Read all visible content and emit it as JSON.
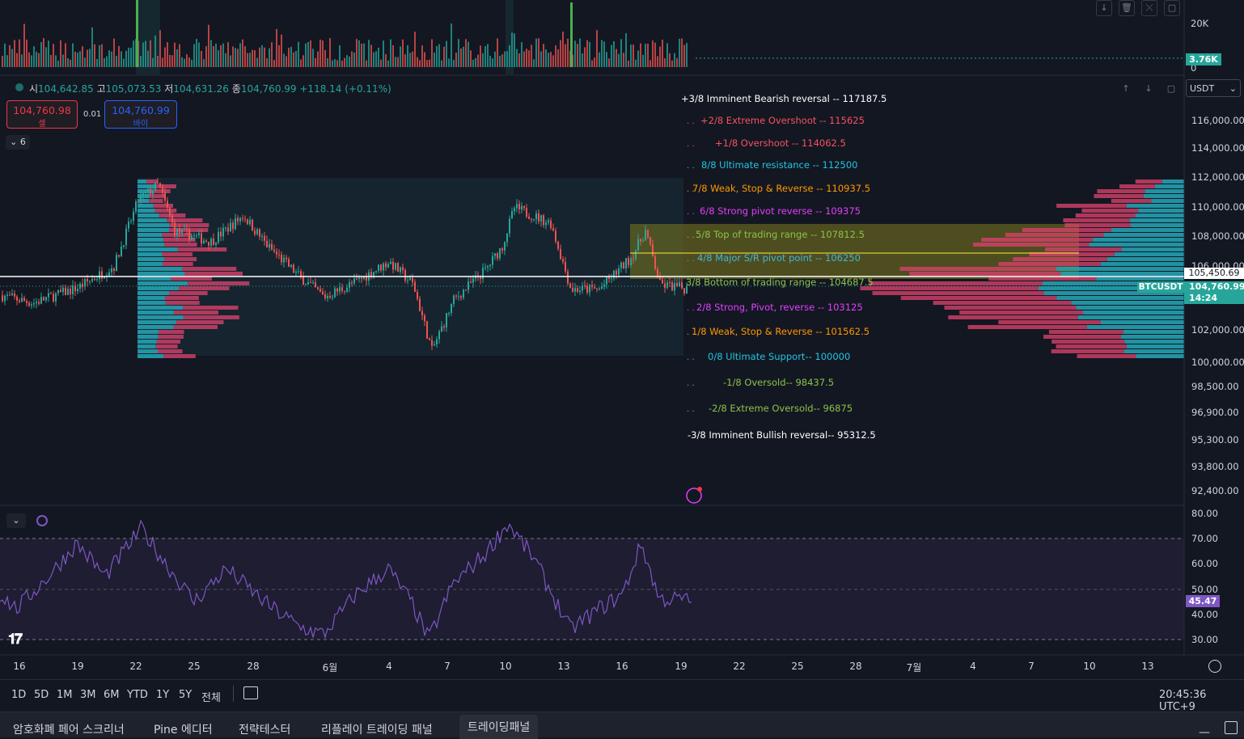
{
  "ohlc": {
    "o_label": "시",
    "o": "104,642.85",
    "h_label": "고",
    "h": "105,073.53",
    "l_label": "저",
    "l": "104,631.26",
    "c_label": "종",
    "c": "104,760.99",
    "change": "+118.14 (+0.11%)"
  },
  "trade": {
    "sell_price": "104,760.98",
    "sell_label": "셀",
    "spread": "0.01",
    "buy_price": "104,760.99",
    "buy_label": "바이"
  },
  "indicator_count": "6",
  "currency": "USDT",
  "volume_axis": {
    "top": "20K",
    "zero": "0",
    "current": "3.76K"
  },
  "price_axis": {
    "labels": [
      "116,000.00",
      "114,000.00",
      "112,000.00",
      "110,000.00",
      "108,000.00",
      "106,000.00",
      "102,000.00",
      "100,000.00",
      "98,500.00",
      "96,900.00",
      "95,300.00",
      "93,800.00",
      "92,400.00"
    ],
    "line_price": "105,450.69",
    "symbol": "BTCUSDT",
    "last_price": "104,760.99",
    "countdown": "14:24"
  },
  "murrey_math": [
    {
      "text": "+3/8 Imminent Bearish reversal --  117187.5",
      "color": "#ffffff"
    },
    {
      "text": "+2/8 Extreme Overshoot --  115625",
      "color": "#f7525f"
    },
    {
      "text": "+1/8 Overshoot --  114062.5",
      "color": "#f7525f"
    },
    {
      "text": "8/8 Ultimate resistance --  112500",
      "color": "#22c5e0"
    },
    {
      "text": "7/8 Weak, Stop & Reverse --  110937.5",
      "color": "#ff9800"
    },
    {
      "text": "6/8 Strong pivot reverse --  109375",
      "color": "#e040fb"
    },
    {
      "text": "5/8 Top of trading range --  107812.5",
      "color": "#8bc34a"
    },
    {
      "text": "4/8 Major S/R pivot point --  106250",
      "color": "#42b5d8"
    },
    {
      "text": "3/8 Bottom of trading range --  104687.5",
      "color": "#8bc34a"
    },
    {
      "text": "2/8 Strong, Pivot, reverse --  103125",
      "color": "#e040fb"
    },
    {
      "text": "1/8 Weak, Stop & Reverse --  101562.5",
      "color": "#ff9800"
    },
    {
      "text": "0/8 Ultimate Support--  100000",
      "color": "#22c5e0"
    },
    {
      "text": "-1/8 Oversold--  98437.5",
      "color": "#8bc34a"
    },
    {
      "text": "-2/8 Extreme Oversold--  96875",
      "color": "#8bc34a"
    },
    {
      "text": "-3/8 Imminent Bullish reversal--  95312.5",
      "color": "#ffffff"
    }
  ],
  "rsi_axis": {
    "labels": [
      "80.00",
      "70.00",
      "60.00",
      "50.00",
      "40.00",
      "30.00"
    ],
    "current": "45.47"
  },
  "time_axis": [
    "16",
    "19",
    "22",
    "25",
    "28",
    "6월",
    "4",
    "7",
    "10",
    "13",
    "16",
    "19",
    "22",
    "25",
    "28",
    "7월",
    "4",
    "7",
    "10",
    "13"
  ],
  "ranges": [
    "1D",
    "5D",
    "1M",
    "3M",
    "6M",
    "YTD",
    "1Y",
    "5Y",
    "전체"
  ],
  "clock": "20:45:36 UTC+9",
  "tabs": [
    "암호화폐 페어 스크리너",
    "Pine 에디터",
    "전략테스터",
    "리플레이 트레이딩 패널",
    "트레이딩패널"
  ],
  "colors": {
    "up": "#26a69a",
    "down": "#ef5350",
    "rsi": "#7e57c2",
    "bg": "#131722"
  }
}
